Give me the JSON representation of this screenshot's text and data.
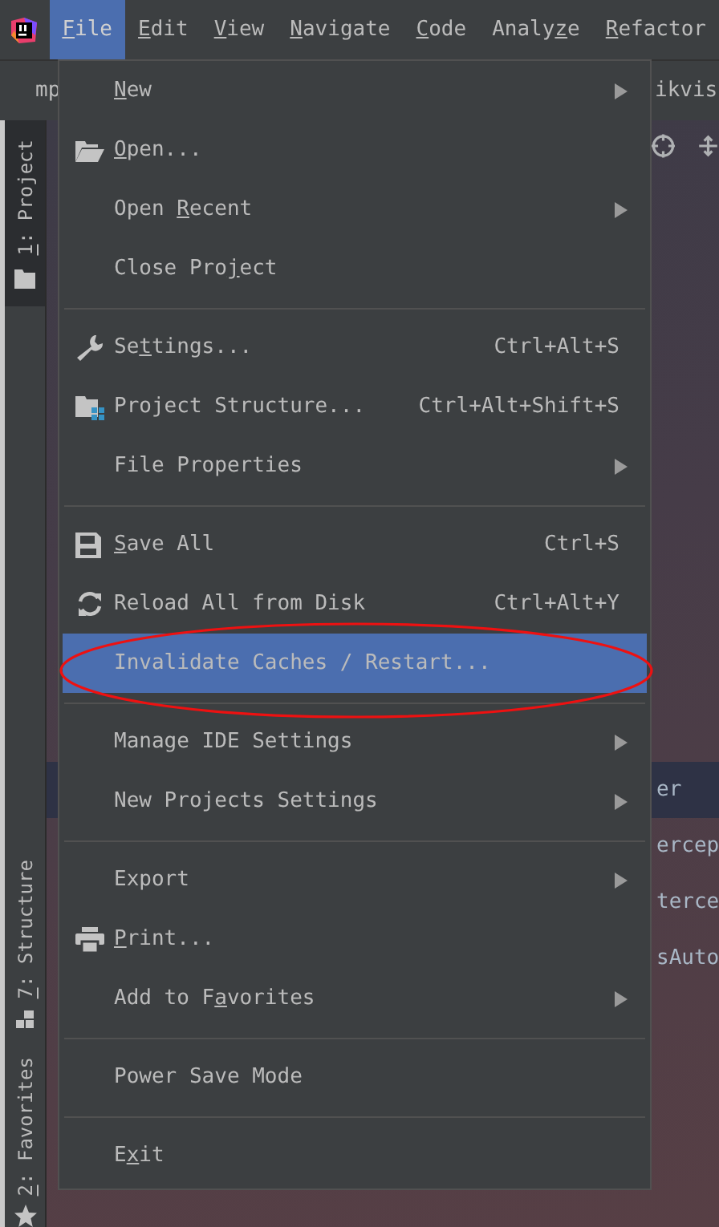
{
  "menubar": [
    {
      "label": [
        {
          "text": "F",
          "underlined": true
        },
        {
          "text": "ile",
          "underlined": false
        }
      ],
      "selected": true
    },
    {
      "label": [
        {
          "text": "E",
          "underlined": true
        },
        {
          "text": "dit",
          "underlined": false
        }
      ],
      "selected": false
    },
    {
      "label": [
        {
          "text": "V",
          "underlined": true
        },
        {
          "text": "iew",
          "underlined": false
        }
      ],
      "selected": false
    },
    {
      "label": [
        {
          "text": "N",
          "underlined": true
        },
        {
          "text": "avigate",
          "underlined": false
        }
      ],
      "selected": false
    },
    {
      "label": [
        {
          "text": "C",
          "underlined": true
        },
        {
          "text": "ode",
          "underlined": false
        }
      ],
      "selected": false
    },
    {
      "label": [
        {
          "text": "Analy",
          "underlined": false
        },
        {
          "text": "z",
          "underlined": true
        },
        {
          "text": "e",
          "underlined": false
        }
      ],
      "selected": false
    },
    {
      "label": [
        {
          "text": "R",
          "underlined": true
        },
        {
          "text": "efactor",
          "underlined": false
        }
      ],
      "selected": false
    }
  ],
  "editor_tabs": [
    "mp",
    "ikvis"
  ],
  "tool_windows": [
    {
      "label": [
        {
          "text": "1",
          "underlined": true
        },
        {
          "text": ": Project",
          "underlined": false
        }
      ],
      "selected": true
    },
    {
      "label": [
        {
          "text": "7",
          "underlined": true
        },
        {
          "text": ": Structure",
          "underlined": false
        }
      ],
      "selected": false
    },
    {
      "label": [
        {
          "text": "2",
          "underlined": true
        },
        {
          "text": ": Favorites",
          "underlined": false
        }
      ],
      "selected": false
    }
  ],
  "menu": {
    "groups": [
      [
        {
          "label": [
            {
              "text": "N",
              "underlined": true
            },
            {
              "text": "ew",
              "underlined": false
            }
          ],
          "submenu": true,
          "selected": false
        },
        {
          "label": [
            {
              "text": "O",
              "underlined": true
            },
            {
              "text": "pen...",
              "underlined": false
            }
          ],
          "submenu": false,
          "selected": false
        },
        {
          "label": [
            {
              "text": "Open ",
              "underlined": false
            },
            {
              "text": "R",
              "underlined": true
            },
            {
              "text": "ecent",
              "underlined": false
            }
          ],
          "submenu": true,
          "selected": false
        },
        {
          "label": [
            {
              "text": "Close Pro",
              "underlined": false
            },
            {
              "text": "j",
              "underlined": true
            },
            {
              "text": "ect",
              "underlined": false
            }
          ],
          "submenu": false,
          "selected": false
        }
      ],
      [
        {
          "label": [
            {
              "text": "Se",
              "underlined": false
            },
            {
              "text": "t",
              "underlined": true
            },
            {
              "text": "tings...",
              "underlined": false
            }
          ],
          "shortcut": "Ctrl+Alt+S",
          "submenu": false,
          "selected": false
        },
        {
          "label": [
            {
              "text": "Project Structure...",
              "underlined": false
            }
          ],
          "shortcut": "Ctrl+Alt+Shift+S",
          "submenu": false,
          "selected": false
        },
        {
          "label": [
            {
              "text": "File Properties",
              "underlined": false
            }
          ],
          "submenu": true,
          "selected": false
        }
      ],
      [
        {
          "label": [
            {
              "text": "S",
              "underlined": true
            },
            {
              "text": "ave All",
              "underlined": false
            }
          ],
          "shortcut": "Ctrl+S",
          "submenu": false,
          "selected": false
        },
        {
          "label": [
            {
              "text": "Reload All from Disk",
              "underlined": false
            }
          ],
          "shortcut": "Ctrl+Alt+Y",
          "submenu": false,
          "selected": false
        },
        {
          "label": [
            {
              "text": "Invalidate Caches / Restart...",
              "underlined": false
            }
          ],
          "submenu": false,
          "selected": true
        }
      ],
      [
        {
          "label": [
            {
              "text": "Manage IDE Settings",
              "underlined": false
            }
          ],
          "submenu": true,
          "selected": false
        },
        {
          "label": [
            {
              "text": "New Projects Settings",
              "underlined": false
            }
          ],
          "submenu": true,
          "selected": false
        }
      ],
      [
        {
          "label": [
            {
              "text": "Export",
              "underlined": false
            }
          ],
          "submenu": true,
          "selected": false
        },
        {
          "label": [
            {
              "text": "P",
              "underlined": true
            },
            {
              "text": "rint...",
              "underlined": false
            }
          ],
          "submenu": false,
          "selected": false
        },
        {
          "label": [
            {
              "text": "Add to F",
              "underlined": false
            },
            {
              "text": "a",
              "underlined": true
            },
            {
              "text": "vorites",
              "underlined": false
            }
          ],
          "submenu": true,
          "selected": false
        }
      ],
      [
        {
          "label": [
            {
              "text": "Power Save Mode",
              "underlined": false
            }
          ],
          "submenu": false,
          "selected": false
        }
      ],
      [
        {
          "label": [
            {
              "text": "E",
              "underlined": false
            },
            {
              "text": "x",
              "underlined": true
            },
            {
              "text": "it",
              "underlined": false
            }
          ],
          "submenu": false,
          "selected": false
        }
      ]
    ]
  },
  "code_lines": [
    {
      "text": "er",
      "selected": true
    },
    {
      "text": "ercep",
      "selected": false
    },
    {
      "text": "terce",
      "selected": false
    },
    {
      "text": "sAuto",
      "selected": false
    }
  ],
  "annotation": {
    "kind": "ellipse"
  }
}
